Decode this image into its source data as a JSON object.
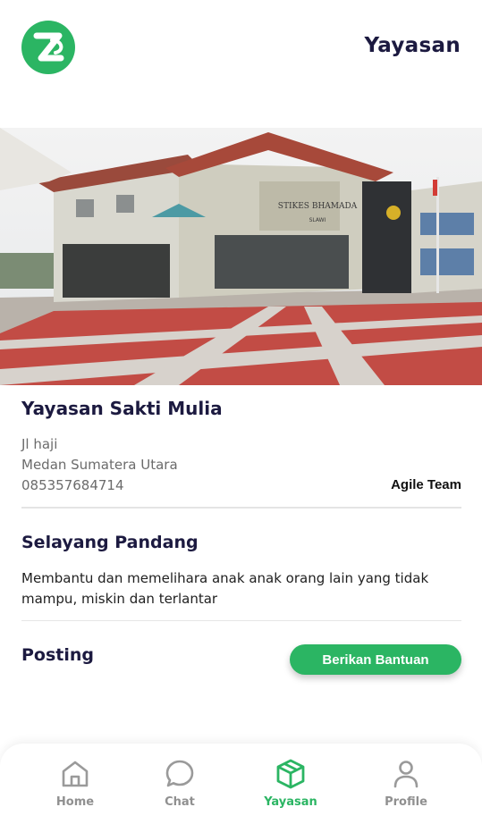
{
  "header": {
    "logo_letter": "Z",
    "title": "Yayasan"
  },
  "hero": {
    "sign_text": "STIKES BHAMADA",
    "sign_sub": "SLAWI"
  },
  "organization": {
    "name": "Yayasan Sakti Mulia",
    "address_line1": "Jl haji",
    "address_line2": "Medan Sumatera Utara",
    "phone": "085357684714",
    "team": "Agile Team"
  },
  "about": {
    "title": "Selayang Pandang",
    "description": "Membantu dan memelihara anak anak orang lain yang tidak mampu, miskin dan terlantar"
  },
  "posting": {
    "title": "Posting",
    "button_label": "Berikan Bantuan"
  },
  "nav": {
    "items": [
      {
        "label": "Home",
        "icon": "home-icon",
        "active": false
      },
      {
        "label": "Chat",
        "icon": "chat-icon",
        "active": false
      },
      {
        "label": "Yayasan",
        "icon": "box-icon",
        "active": true
      },
      {
        "label": "Profile",
        "icon": "profile-icon",
        "active": false
      }
    ]
  },
  "colors": {
    "accent": "#2bb563",
    "title": "#1c1a40",
    "muted": "#909090"
  }
}
